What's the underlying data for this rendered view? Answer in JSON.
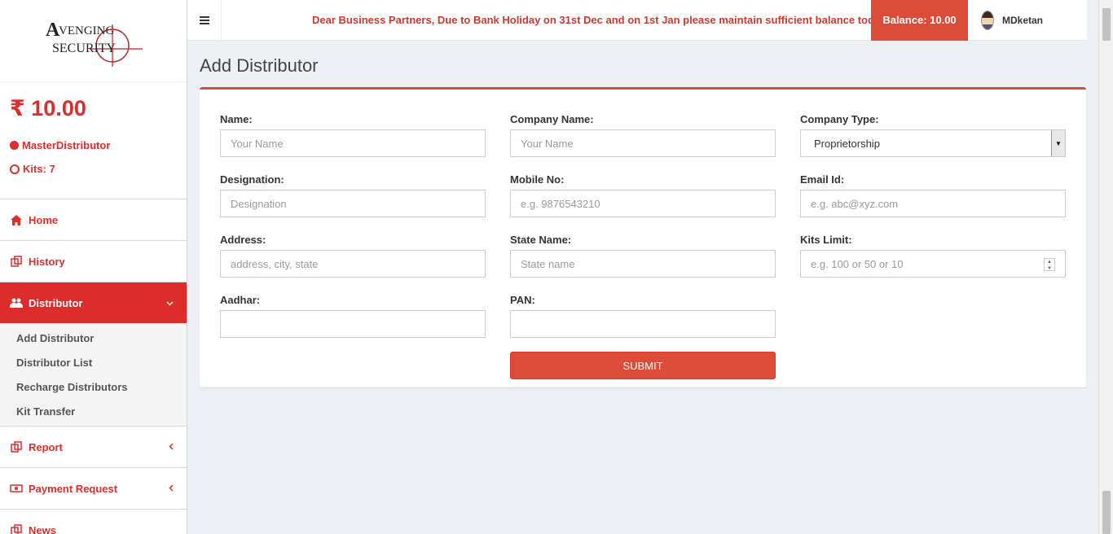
{
  "logo": {
    "text_line1": "VENGING",
    "text_line2": "SECURITY",
    "letter": "A"
  },
  "sidebar": {
    "balance": "₹ 10.00",
    "role": "MasterDistributor",
    "kits": "Kits: 7",
    "menu": [
      {
        "label": "Home",
        "icon": "home-icon"
      },
      {
        "label": "History",
        "icon": "copy-icon"
      },
      {
        "label": "Distributor",
        "icon": "users-icon",
        "chevron": "⌄"
      },
      {
        "label": "Report",
        "icon": "copy-icon",
        "chevron": "‹"
      },
      {
        "label": "Payment Request",
        "icon": "money-icon",
        "chevron": "‹"
      },
      {
        "label": "News",
        "icon": "copy-icon"
      }
    ],
    "submenu": [
      "Add Distributor",
      "Distributor List",
      "Recharge Distributors",
      "Kit Transfer"
    ]
  },
  "header": {
    "marquee": "Dear Business Partners, Due to Bank Holiday on 31st Dec and on 1st Jan please maintain sufficient balance today",
    "balance": "Balance: 10.00",
    "username": "MDketan"
  },
  "page": {
    "title": "Add Distributor"
  },
  "form": {
    "name": {
      "label": "Name:",
      "placeholder": "Your Name"
    },
    "company_name": {
      "label": "Company Name:",
      "placeholder": "Your Name"
    },
    "company_type": {
      "label": "Company Type:",
      "value": "Proprietorship"
    },
    "designation": {
      "label": "Designation:",
      "placeholder": "Designation"
    },
    "mobile": {
      "label": "Mobile No:",
      "placeholder": "e.g. 9876543210"
    },
    "email": {
      "label": "Email Id:",
      "placeholder": "e.g. abc@xyz.com"
    },
    "address": {
      "label": "Address:",
      "placeholder": "address, city, state"
    },
    "state": {
      "label": "State Name:",
      "placeholder": "State name"
    },
    "kits_limit": {
      "label": "Kits Limit:",
      "placeholder": "e.g. 100 or 50 or 10"
    },
    "aadhar": {
      "label": "Aadhar:",
      "placeholder": ""
    },
    "pan": {
      "label": "PAN:",
      "placeholder": ""
    },
    "submit_label": "SUBMIT"
  },
  "colors": {
    "accent": "#dd2c2c",
    "button": "#dd4b39",
    "marquee_text": "#c43b31"
  }
}
